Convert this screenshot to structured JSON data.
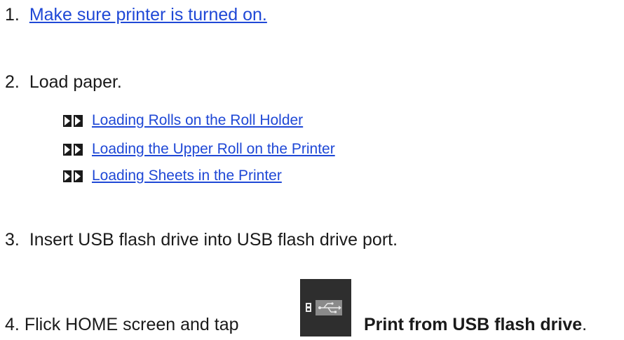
{
  "steps": [
    {
      "number": "1.",
      "link_text": "Make sure printer is turned on."
    },
    {
      "number": "2.",
      "text": "Load paper.",
      "sublinks": [
        {
          "label": "Loading Rolls on the Roll Holder",
          "icon": "double-arrow-icon"
        },
        {
          "label": "Loading the Upper Roll on the Printer",
          "icon": "double-arrow-icon"
        },
        {
          "label": "Loading Sheets in the Printer",
          "icon": "double-arrow-icon"
        }
      ]
    },
    {
      "number": "3.",
      "text": "Insert USB flash drive into USB flash drive port."
    },
    {
      "number": "4.",
      "text": "Flick HOME screen and tap",
      "bold_text": "Print from USB flash drive",
      "trailing": ".",
      "button_icon": "usb-icon"
    }
  ],
  "colors": {
    "link": "#1f48d6",
    "text": "#1a1a1a",
    "bullet": "#1a1a1a",
    "usb_button_bg": "#2e2e2e"
  }
}
